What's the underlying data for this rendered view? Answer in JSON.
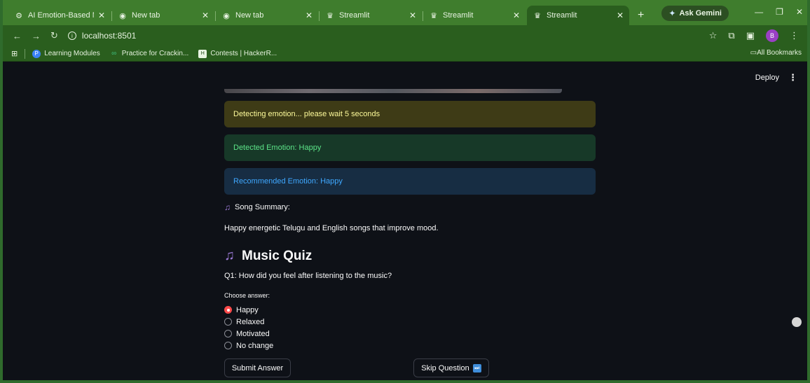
{
  "browser": {
    "tabs": [
      {
        "title": "AI Emotion-Based Mus",
        "icon": "gear-icon",
        "active": false
      },
      {
        "title": "New tab",
        "icon": "chrome-icon",
        "active": false
      },
      {
        "title": "New tab",
        "icon": "chrome-icon",
        "active": false
      },
      {
        "title": "Streamlit",
        "icon": "streamlit-icon",
        "active": false
      },
      {
        "title": "Streamlit",
        "icon": "streamlit-icon",
        "active": false
      },
      {
        "title": "Streamlit",
        "icon": "streamlit-icon",
        "active": true
      }
    ],
    "gemini_label": "Ask Gemini",
    "url": "localhost:8501",
    "bookmarks": [
      {
        "label": "Learning Modules",
        "icon": "p-icon"
      },
      {
        "label": "Practice for Crackin...",
        "icon": "link-icon"
      },
      {
        "label": "Contests | HackerR...",
        "icon": "hackerrank-icon"
      }
    ],
    "all_bookmarks_label": "All Bookmarks",
    "profile_initial": "B",
    "colors": {
      "frame": "#3f7d2d",
      "toolbar": "#2a5e1e"
    }
  },
  "app": {
    "deploy_label": "Deploy",
    "alerts": {
      "warning": "Detecting emotion... please wait 5 seconds",
      "success": "Detected Emotion: Happy",
      "info": "Recommended Emotion: Happy"
    },
    "summary_heading": "Song Summary:",
    "summary_text": "Happy energetic Telugu and English songs that improve mood.",
    "quiz_title": "Music Quiz",
    "question": "Q1: How did you feel after listening to the music?",
    "choose_label": "Choose answer:",
    "options": [
      "Happy",
      "Relaxed",
      "Motivated",
      "No change"
    ],
    "selected_option": "Happy",
    "submit_label": "Submit Answer",
    "skip_label": "Skip Question",
    "colors": {
      "background": "#0e1117",
      "accent": "#ff4b4b",
      "warning": "#fdfa9a",
      "success": "#5ce488",
      "info": "#3fa8ff"
    }
  }
}
